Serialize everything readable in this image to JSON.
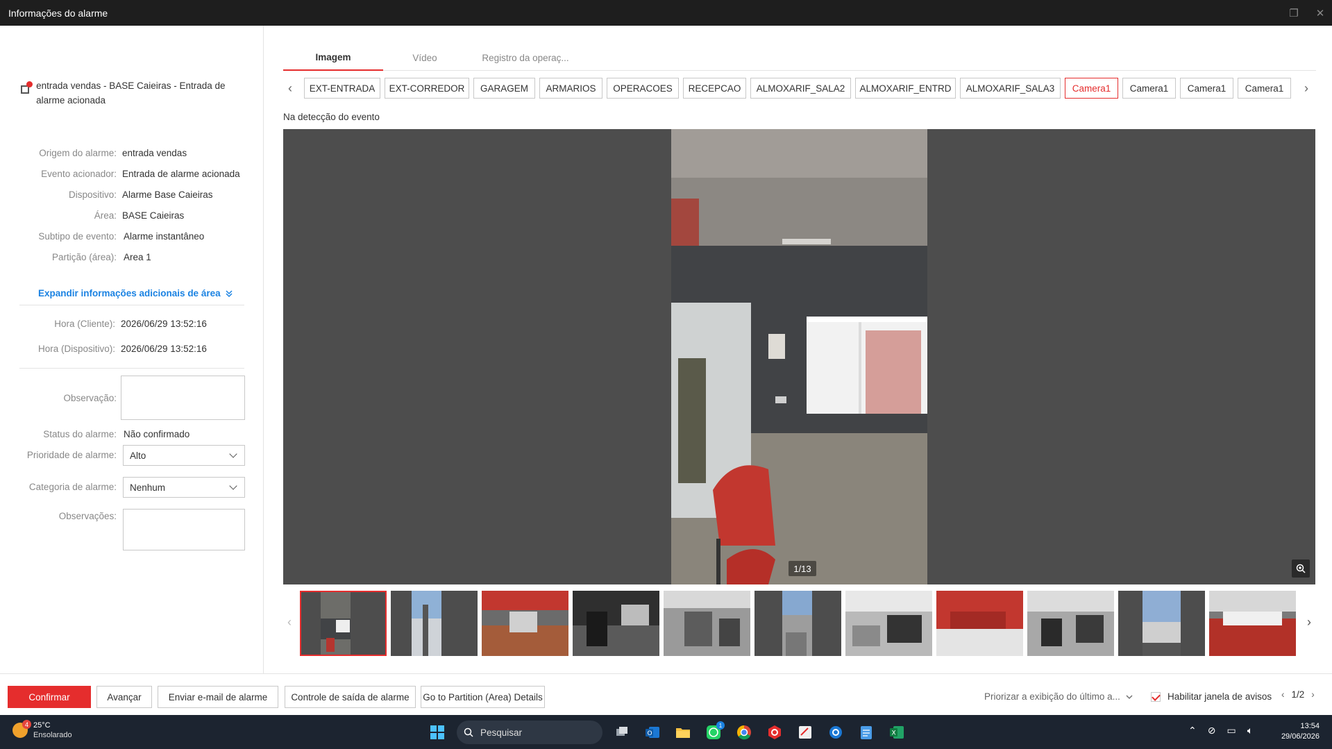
{
  "window": {
    "title": "Informações do alarme"
  },
  "alarm": {
    "heading": "entrada vendas - BASE Caieiras - Entrada de alarme acionada"
  },
  "details": [
    {
      "label": "Origem do alarme:",
      "value": "entrada vendas"
    },
    {
      "label": "Evento acionador:",
      "value": "Entrada de alarme acionada"
    },
    {
      "label": "Dispositivo:",
      "value": "Alarme Base Caieiras"
    },
    {
      "label": "Área:",
      "value": "BASE Caieiras"
    },
    {
      "label": "Subtipo de evento:",
      "value": "Alarme instantâneo"
    },
    {
      "label": "Partição (área):",
      "value": "Area 1"
    }
  ],
  "expand_label": "Expandir informações adicionais de área",
  "times": [
    {
      "label": "Hora (Cliente):",
      "value": "2026/06/29 13:52:16"
    },
    {
      "label": "Hora (Dispositivo):",
      "value": "2026/06/29 13:52:16"
    }
  ],
  "form": {
    "observation_label": "Observação:",
    "status_label": "Status do alarme:",
    "status_value": "Não confirmado",
    "priority_label": "Prioridade de alarme:",
    "priority_value": "Alto",
    "category_label": "Categoria de alarme:",
    "category_value": "Nenhum",
    "notes_label": "Observações:"
  },
  "tabs": [
    {
      "label": "Imagem",
      "active": true
    },
    {
      "label": "Vídeo",
      "active": false
    },
    {
      "label": "Registro da operaç...",
      "active": false
    }
  ],
  "cameras": [
    "EXT-ENTRADA",
    "EXT-CORREDOR",
    "GARAGEM",
    "ARMARIOS",
    "OPERACOES",
    "RECEPCAO",
    "ALMOXARIF_SALA2",
    "ALMOXARIF_ENTRD",
    "ALMOXARIF_SALA3",
    "Camera1",
    "Camera1",
    "Camera1",
    "Camera1"
  ],
  "selected_camera_index": 9,
  "image": {
    "caption": "Na detecção do evento",
    "counter": "1/13"
  },
  "thumbnails_selected_index": 0,
  "buttons": {
    "confirm": "Confirmar",
    "advance": "Avançar",
    "email": "Enviar e-mail de alarme",
    "output": "Controle de saída de alarme",
    "partition": "Go to Partition (Area) Details"
  },
  "footer": {
    "priority_display": "Priorizar a exibição do último a...",
    "enable_popup": "Habilitar janela de avisos",
    "page": "1/2"
  },
  "taskbar": {
    "temperature": "25°C",
    "weather": "Ensolarado",
    "weather_badge": "4",
    "search_placeholder": "Pesquisar",
    "whatsapp_badge": "1",
    "time": "13:54",
    "date": "29/06/2026"
  },
  "colors": {
    "accent": "#e52d2d",
    "link": "#1a82e2",
    "taskbar": "#1c2430"
  }
}
